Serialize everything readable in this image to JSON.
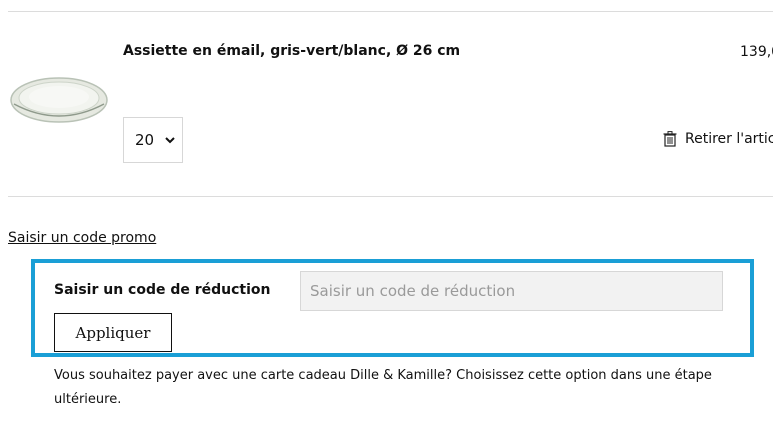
{
  "cart": {
    "item": {
      "name": "Assiette en émail, gris-vert/blanc, Ø 26 cm",
      "price": "139,0",
      "quantity": "20",
      "remove_label": "Retirer l'artic"
    }
  },
  "promo": {
    "link_label": "Saisir un code promo",
    "field_label": "Saisir un code de réduction",
    "input_placeholder": "Saisir un code de réduction",
    "input_value": "",
    "apply_label": "Appliquer",
    "gift_card_note": "Vous souhaitez payer avec une carte cadeau Dille & Kamille? Choisissez cette option dans une étape ultérieure."
  },
  "colors": {
    "highlight_border": "#1a9fd6",
    "input_background": "#f2f2f2",
    "divider": "#dcdcdc"
  },
  "icons": {
    "quantity_dropdown": "chevron-down-icon",
    "remove": "trash-icon",
    "product": "plate-image"
  }
}
